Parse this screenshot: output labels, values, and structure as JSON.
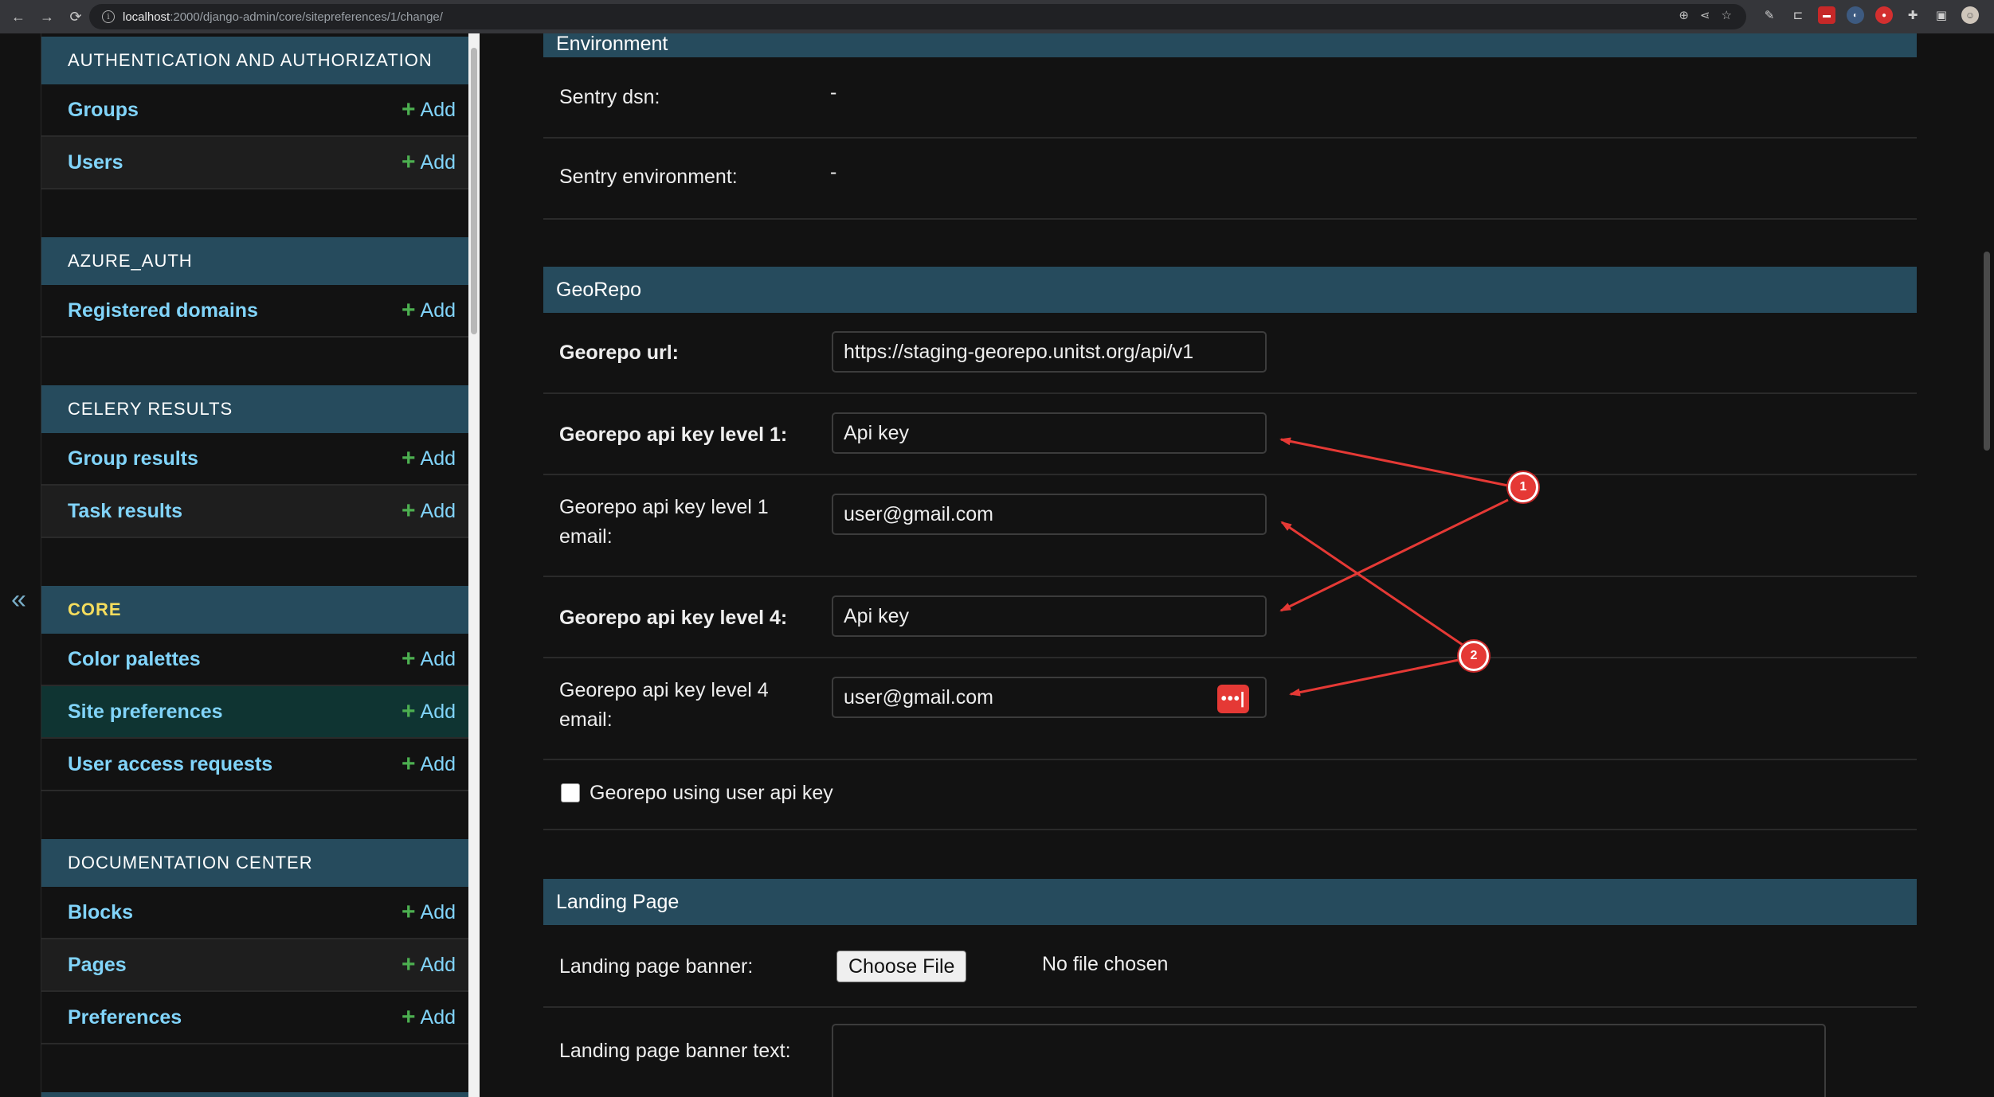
{
  "browser": {
    "url_host": "localhost",
    "url_path": ":2000/django-admin/core/sitepreferences/1/change/"
  },
  "sidebar": {
    "modules": [
      {
        "caption": "AUTHENTICATION AND AUTHORIZATION",
        "models": [
          {
            "label": "Groups",
            "add": "Add"
          },
          {
            "label": "Users",
            "add": "Add"
          }
        ]
      },
      {
        "caption": "AZURE_AUTH",
        "models": [
          {
            "label": "Registered domains",
            "add": "Add"
          }
        ]
      },
      {
        "caption": "CELERY RESULTS",
        "models": [
          {
            "label": "Group results",
            "add": "Add"
          },
          {
            "label": "Task results",
            "add": "Add"
          }
        ]
      },
      {
        "caption": "CORE",
        "models": [
          {
            "label": "Color palettes",
            "add": "Add"
          },
          {
            "label": "Site preferences",
            "add": "Add"
          },
          {
            "label": "User access requests",
            "add": "Add"
          }
        ]
      },
      {
        "caption": "DOCUMENTATION CENTER",
        "models": [
          {
            "label": "Blocks",
            "add": "Add"
          },
          {
            "label": "Pages",
            "add": "Add"
          },
          {
            "label": "Preferences",
            "add": "Add"
          }
        ]
      }
    ]
  },
  "main": {
    "environment": {
      "header": "Environment",
      "sentry_dsn_label": "Sentry dsn:",
      "sentry_dsn_value": "-",
      "sentry_env_label": "Sentry environment:",
      "sentry_env_value": "-"
    },
    "georepo": {
      "header": "GeoRepo",
      "url_label": "Georepo url:",
      "url_value": "https://staging-georepo.unitst.org/api/v1",
      "key1_label": "Georepo api key level 1:",
      "key1_value": "Api key",
      "key1_email_label_1": "Georepo api key level 1",
      "key1_email_label_2": "email:",
      "key1_email_value": "user@gmail.com",
      "key4_label": "Georepo api key level 4:",
      "key4_value": "Api key",
      "key4_email_label_1": "Georepo api key level 4",
      "key4_email_label_2": "email:",
      "key4_email_value": "user@gmail.com",
      "password_icon_text": "•••|",
      "user_api_key_label": "Georepo using user api key"
    },
    "landing": {
      "header": "Landing Page",
      "banner_label": "Landing page banner:",
      "choose_file": "Choose File",
      "no_file": "No file chosen",
      "banner_text_label": "Landing page banner text:"
    }
  },
  "annotations": {
    "badge1": "1",
    "badge2": "2",
    "arrow_color": "#e53935"
  },
  "collapse_icon": "«"
}
